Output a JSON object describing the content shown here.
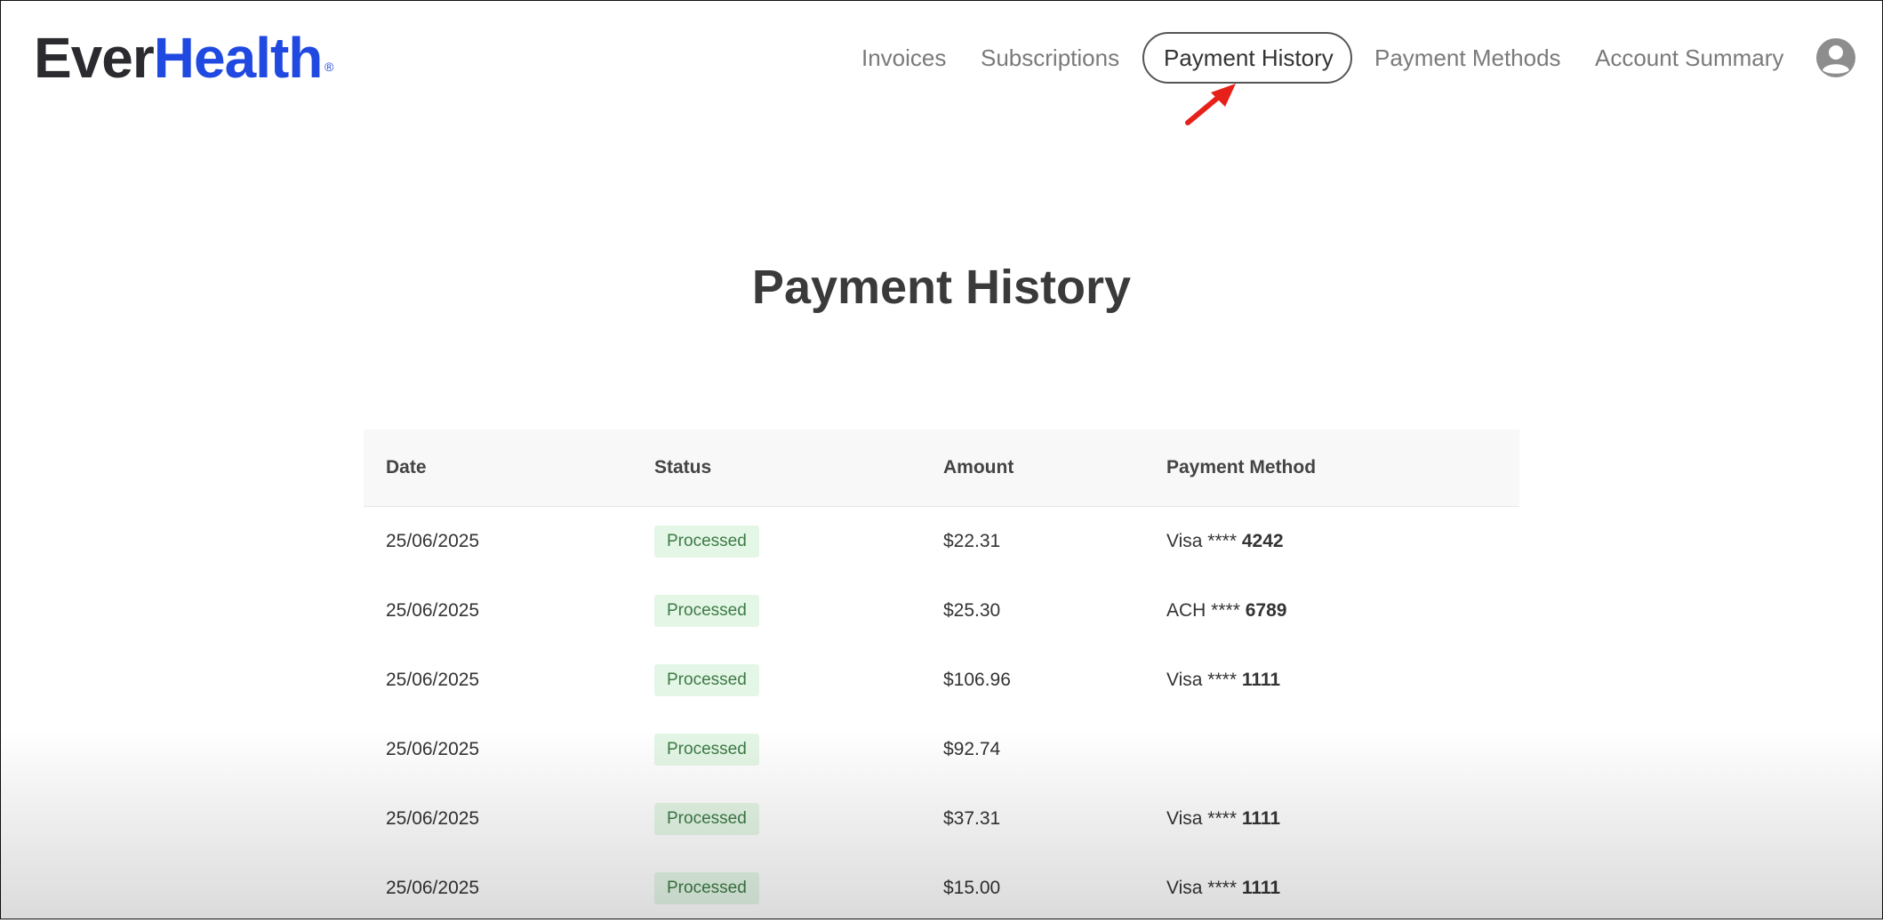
{
  "brand": {
    "part1": "Ever",
    "part2": "Health",
    "registered": "®"
  },
  "nav": {
    "invoices": "Invoices",
    "subscriptions": "Subscriptions",
    "payment_history": "Payment History",
    "payment_methods": "Payment Methods",
    "account_summary": "Account Summary"
  },
  "page": {
    "title": "Payment History"
  },
  "table": {
    "headers": [
      "Date",
      "Status",
      "Amount",
      "Payment Method"
    ],
    "rows": [
      {
        "date": "25/06/2025",
        "status": "Processed",
        "amount": "$22.31",
        "method_type": "Visa ****",
        "method_last4": "4242"
      },
      {
        "date": "25/06/2025",
        "status": "Processed",
        "amount": "$25.30",
        "method_type": "ACH ****",
        "method_last4": "6789"
      },
      {
        "date": "25/06/2025",
        "status": "Processed",
        "amount": "$106.96",
        "method_type": "Visa ****",
        "method_last4": "1111"
      },
      {
        "date": "25/06/2025",
        "status": "Processed",
        "amount": "$92.74",
        "method_type": "",
        "method_last4": ""
      },
      {
        "date": "25/06/2025",
        "status": "Processed",
        "amount": "$37.31",
        "method_type": "Visa ****",
        "method_last4": "1111"
      },
      {
        "date": "25/06/2025",
        "status": "Processed",
        "amount": "$15.00",
        "method_type": "Visa ****",
        "method_last4": "1111"
      }
    ]
  },
  "colors": {
    "brand_dark": "#2b2b2f",
    "brand_blue": "#1f49e0",
    "status_bg": "#e4f6e6",
    "status_text": "#3c7a45",
    "annotation_arrow": "#e8201a"
  },
  "icons": {
    "avatar": "user-avatar-icon",
    "pointer": "red-arrow-annotation"
  }
}
